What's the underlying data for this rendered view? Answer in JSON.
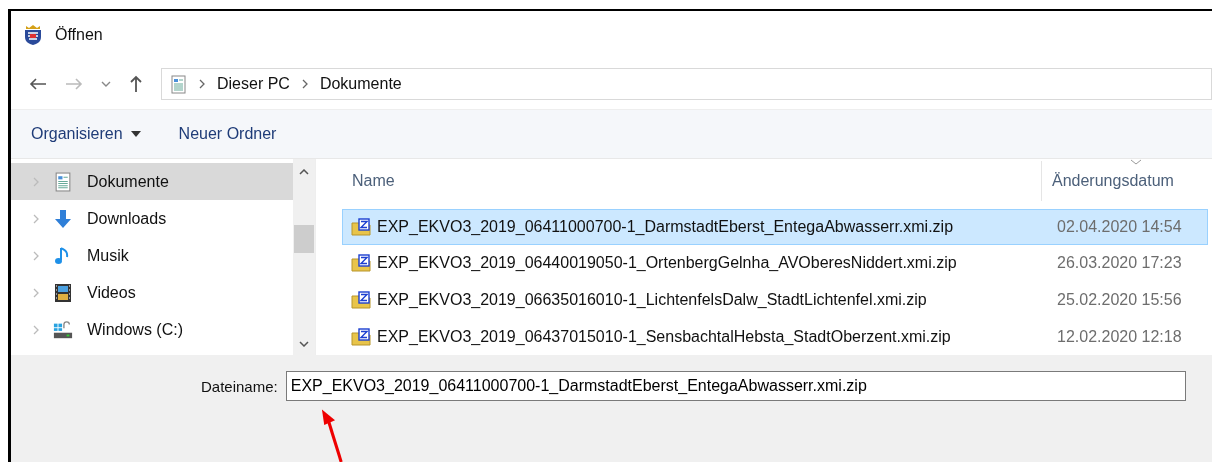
{
  "window": {
    "title": "Öffnen"
  },
  "address": {
    "path": [
      {
        "label": "Dieser PC"
      },
      {
        "label": "Dokumente"
      }
    ]
  },
  "toolbar": [
    {
      "label": "Organisieren",
      "kind": "menu"
    },
    {
      "label": "Neuer Ordner",
      "kind": "plain"
    }
  ],
  "sidebar": {
    "items": [
      {
        "label": "Dokumente",
        "kind": "documents",
        "selected": true
      },
      {
        "label": "Downloads",
        "kind": "downloads",
        "selected": false
      },
      {
        "label": "Musik",
        "kind": "music",
        "selected": false
      },
      {
        "label": "Videos",
        "kind": "videos",
        "selected": false
      },
      {
        "label": "Windows (C:)",
        "kind": "drive",
        "selected": false
      }
    ]
  },
  "table": {
    "columns": [
      "Name",
      "Änderungsdatum"
    ],
    "rows": [
      {
        "name": "EXP_EKVO3_2019_06411000700-1_DarmstadtEberst_EntegaAbwasserr.xmi.zip",
        "date": "02.04.2020 14:54",
        "selected": true
      },
      {
        "name": "EXP_EKVO3_2019_06440019050-1_OrtenbergGelnha_AVOberesNiddert.xmi.zip",
        "date": "26.03.2020 17:23",
        "selected": false
      },
      {
        "name": "EXP_EKVO3_2019_06635016010-1_LichtenfelsDalw_StadtLichtenfel.xmi.zip",
        "date": "25.02.2020 15:56",
        "selected": false
      },
      {
        "name": "EXP_EKVO3_2019_06437015010-1_SensbachtalHebsta_StadtOberzent.xmi.zip",
        "date": "12.02.2020 12:18",
        "selected": false
      }
    ]
  },
  "filename": {
    "label": "Dateiname:",
    "value": "EXP_EKVO3_2019_06411000700-1_DarmstadtEberst_EntegaAbwasserr.xmi.zip"
  }
}
